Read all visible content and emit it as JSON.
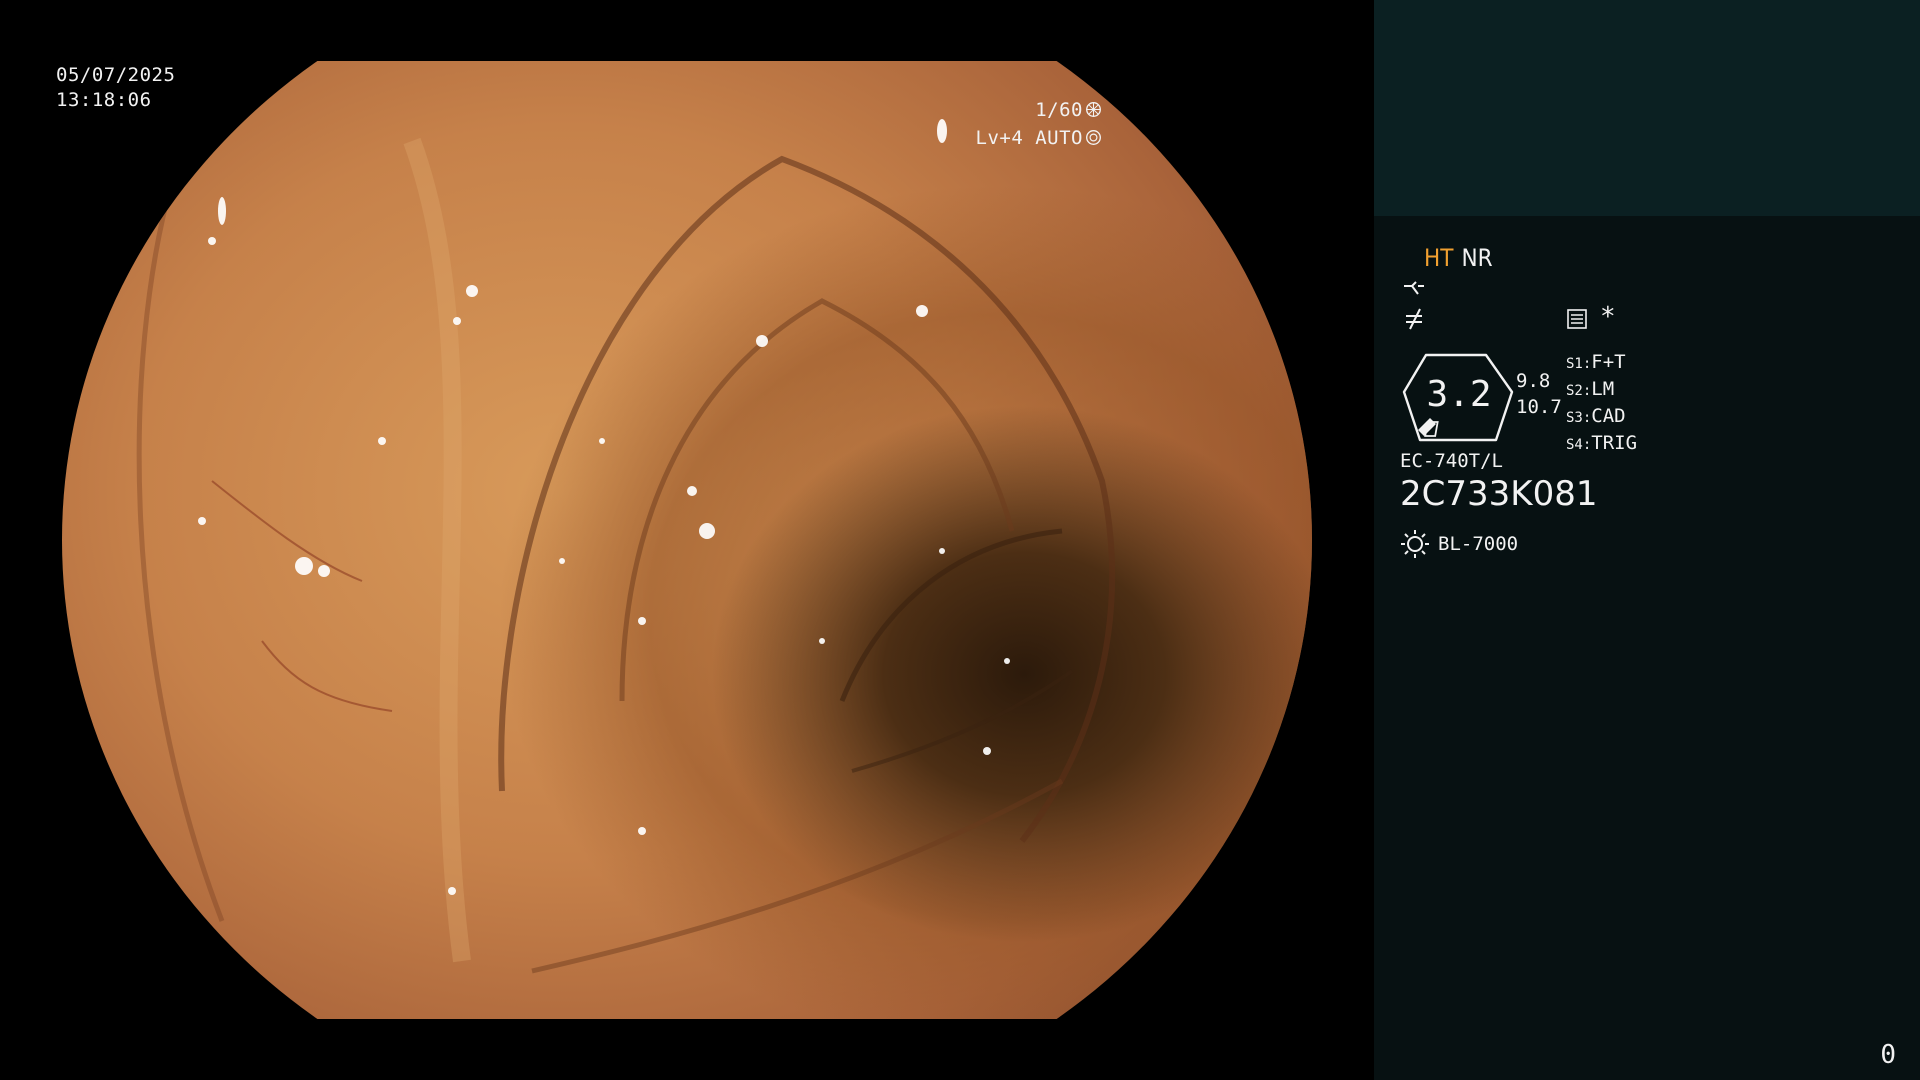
{
  "overlay": {
    "date": "05/07/2025",
    "time": "13:18:06",
    "shutter": "1/60",
    "exposure": "Lv+4 AUTO"
  },
  "panel": {
    "mode_ht": "HT",
    "mode_nr": "NR",
    "star": "*",
    "zoom": {
      "value": "3.2",
      "sub1": "9.8",
      "sub2": "10.7"
    },
    "switches": [
      {
        "label": "S1",
        "value": "F+T"
      },
      {
        "label": "S2",
        "value": "LM"
      },
      {
        "label": "S3",
        "value": "CAD"
      },
      {
        "label": "S4",
        "value": "TRIG"
      }
    ],
    "scope_model": "EC-740T/L",
    "scope_serial": "2C733K081",
    "light_source": "BL-7000",
    "counter": "0"
  },
  "colors": {
    "panel_top": "#0b2022",
    "panel_bottom": "#071112",
    "ht_accent": "#f0a030",
    "mucosa": "#c6814a",
    "lumen": "#2c1a0b"
  }
}
